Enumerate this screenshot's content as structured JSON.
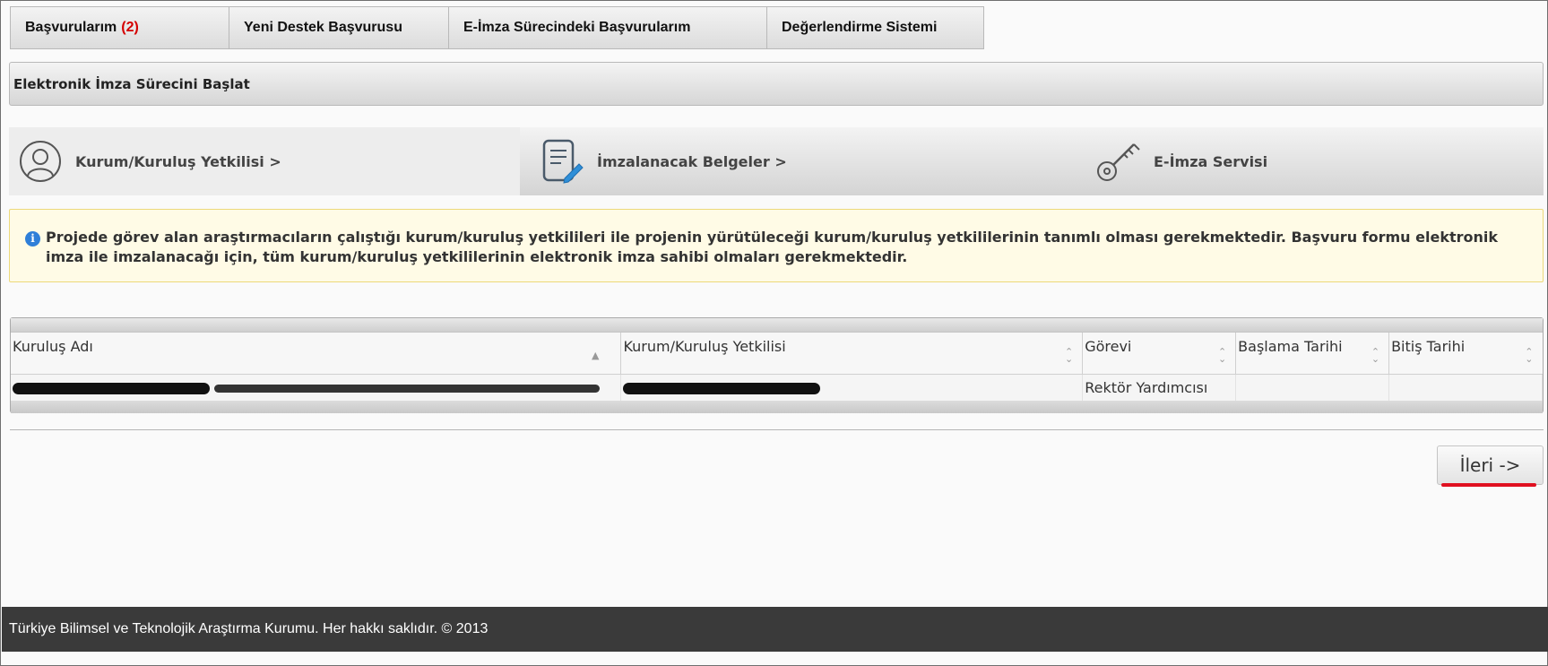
{
  "tabs": {
    "applications_label": "Başvurularım",
    "applications_count": "(2)",
    "new_support_label": "Yeni Destek Başvurusu",
    "esign_applications_label": "E-İmza Sürecindeki Başvurularım",
    "evaluation_label": "Değerlendirme Sistemi"
  },
  "section": {
    "title": "Elektronik İmza Sürecini Başlat"
  },
  "steps": [
    {
      "label": "Kurum/Kuruluş Yetkilisi >",
      "icon": "user-circle-icon"
    },
    {
      "label": "İmzalanacak Belgeler >",
      "icon": "document-edit-icon"
    },
    {
      "label": "E-İmza Servisi",
      "icon": "key-icon"
    }
  ],
  "info": {
    "text": "Projede görev alan araştırmacıların çalıştığı kurum/kuruluş yetkilileri ile projenin yürütüleceği kurum/kuruluş yetkililerinin tanımlı olması gerekmektedir. Başvuru formu elektronik imza ile imzalanacağı için, tüm kurum/kuruluş yetkililerinin elektronik imza sahibi olmaları gerekmektedir."
  },
  "table": {
    "columns": [
      "Kuruluş Adı",
      "Kurum/Kuruluş Yetkilisi",
      "Görevi",
      "Başlama Tarihi",
      "Bitiş Tarihi"
    ],
    "rows": [
      {
        "position": "Rektör Yardımcısı"
      }
    ]
  },
  "actions": {
    "next_label": "İleri ->"
  },
  "footer": {
    "text": "Türkiye Bilimsel ve Teknolojik Araştırma Kurumu. Her hakkı saklıdır. © 2013"
  },
  "colors": {
    "count_red": "#d40000",
    "info_blue": "#2f7fd8",
    "underline_red": "#e01020",
    "footer_bg": "#3a3a3a"
  }
}
